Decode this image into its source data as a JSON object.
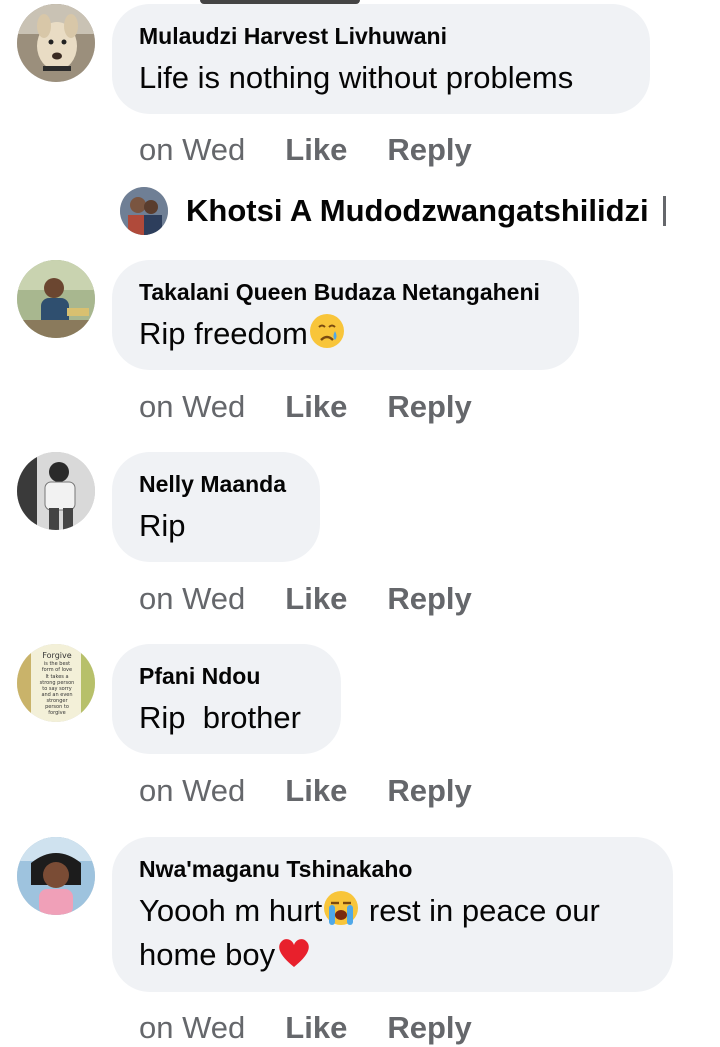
{
  "comments": [
    {
      "author": "Mulaudzi Harvest Livhuwani",
      "text": "Life is nothing without problems",
      "time": "on Wed",
      "like": "Like",
      "reply": "Reply",
      "avatar_icon": "dog-avatar"
    },
    {
      "author": "Takalani Queen Budaza Netangaheni",
      "text": "Rip freedom",
      "time": "on Wed",
      "like": "Like",
      "reply": "Reply",
      "avatar_icon": "person-avatar",
      "emoji": "crying-face-emoji"
    },
    {
      "author": "Nelly Maanda",
      "text": "Rip",
      "time": "on Wed",
      "like": "Like",
      "reply": "Reply",
      "avatar_icon": "person-bw-avatar"
    },
    {
      "author": "Pfani Ndou",
      "text": "Rip  brother",
      "time": "on Wed",
      "like": "Like",
      "reply": "Reply",
      "avatar_icon": "quote-avatar"
    },
    {
      "author": "Nwa'maganu Tshinakaho",
      "text_line1": "Yoooh m hurt",
      "text_line1b": " rest in peace our",
      "text_line2": "home boy",
      "time": "on Wed",
      "like": "Like",
      "reply": "Reply",
      "avatar_icon": "child-avatar",
      "emoji1": "loudly-crying-face-emoji",
      "emoji2": "red-heart-emoji"
    }
  ],
  "reply_author": "Khotsi A Mudodzwangatshilidzi",
  "avatar_quote_text": [
    "Forgive",
    "is the best",
    "form of love",
    "It takes a",
    "strong person",
    "to say sorry",
    "and an even",
    "stronger",
    "person to",
    "forgive"
  ],
  "colors": {
    "bubble": "#f0f2f5",
    "meta": "#65676b",
    "text": "#050505"
  }
}
